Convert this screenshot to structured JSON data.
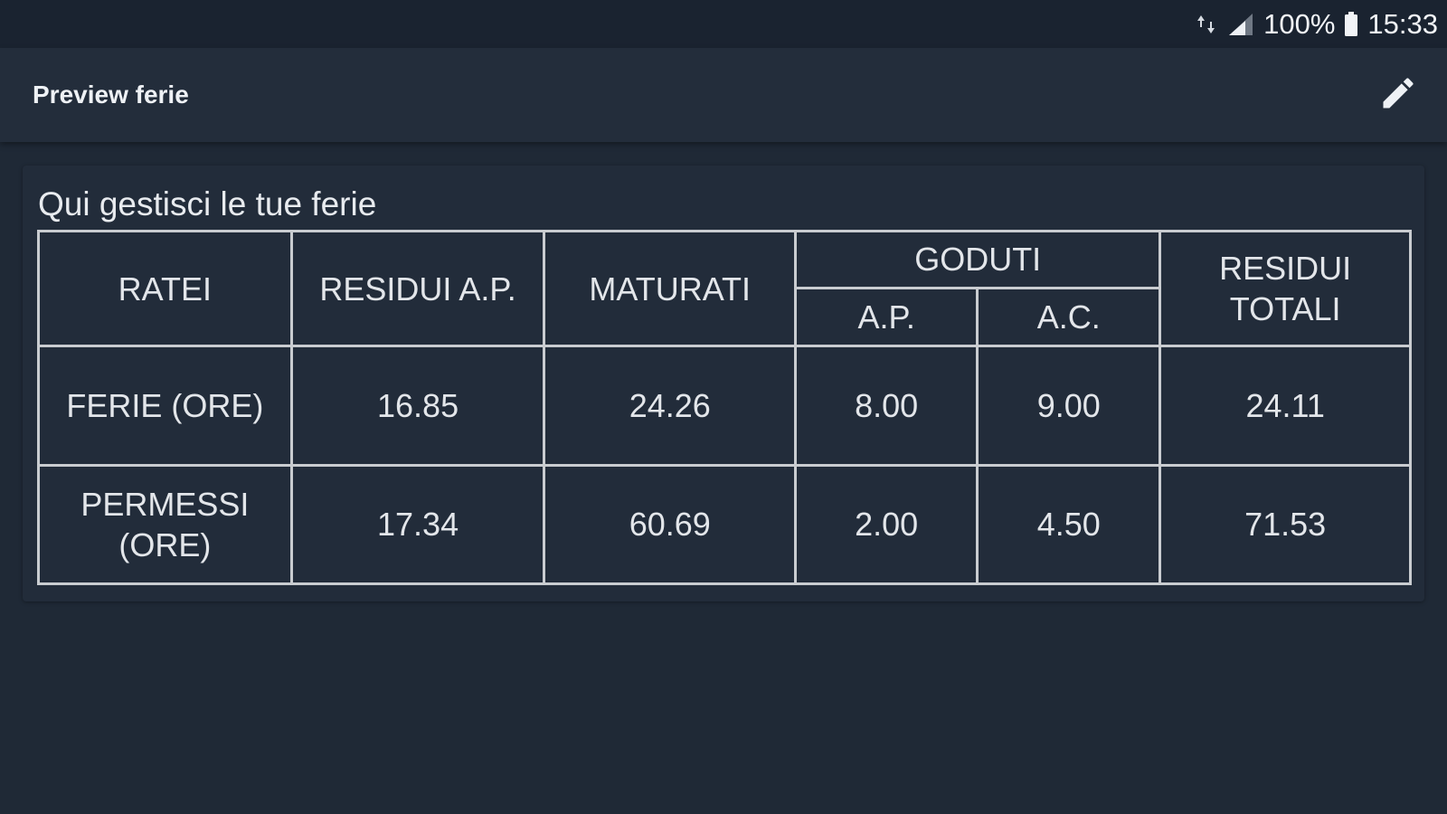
{
  "status_bar": {
    "battery": "100%",
    "time": "15:33"
  },
  "app_bar": {
    "title": "Preview ferie",
    "edit_icon": "pencil-icon"
  },
  "card": {
    "heading": "Qui gestisci le tue ferie",
    "table": {
      "headers": {
        "ratei": "RATEI",
        "residui_ap": "RESIDUI A.P.",
        "maturati": "MATURATI",
        "goduti": "GODUTI",
        "goduti_ap": "A.P.",
        "goduti_ac": "A.C.",
        "residui_totali_line1": "RESIDUI",
        "residui_totali_line2": "TOTALI"
      },
      "rows": [
        {
          "label_line1": "FERIE (ORE)",
          "label_line2": "",
          "residui_ap": "16.85",
          "maturati": "24.26",
          "goduti_ap": "8.00",
          "goduti_ac": "9.00",
          "residui_totali": "24.11"
        },
        {
          "label_line1": "PERMESSI",
          "label_line2": "(ORE)",
          "residui_ap": "17.34",
          "maturati": "60.69",
          "goduti_ap": "2.00",
          "goduti_ac": "4.50",
          "residui_totali": "71.53"
        }
      ]
    }
  }
}
